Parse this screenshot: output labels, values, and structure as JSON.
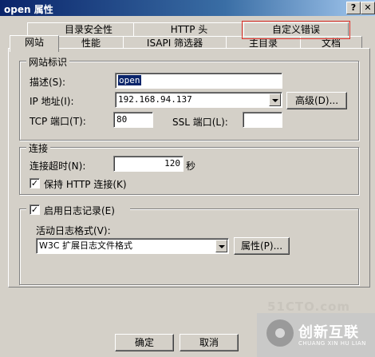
{
  "window": {
    "title": "open 属性",
    "help_label": "?",
    "close_label": "✕"
  },
  "tabs_row1": [
    "目录安全性",
    "HTTP 头",
    "自定义错误"
  ],
  "tabs_row2": [
    "网站",
    "性能",
    "ISAPI 筛选器",
    "主目录",
    "文档"
  ],
  "site_identity": {
    "group_title": "网站标识",
    "description_label": "描述(S):",
    "description_value": "open",
    "ip_label": "IP 地址(I):",
    "ip_value": "192.168.94.137",
    "advanced_button": "高级(D)...",
    "tcp_label": "TCP 端口(T):",
    "tcp_value": "80",
    "ssl_label": "SSL 端口(L):",
    "ssl_value": ""
  },
  "connections": {
    "group_title": "连接",
    "timeout_label": "连接超时(N):",
    "timeout_value": "120",
    "timeout_unit": "秒",
    "keepalive_label": "保持 HTTP 连接(K)",
    "keepalive_checked": true
  },
  "logging": {
    "enable_label": "启用日志记录(E)",
    "enable_checked": true,
    "format_label": "活动日志格式(V):",
    "format_value": "W3C 扩展日志文件格式",
    "properties_button": "属性(P)..."
  },
  "footer": {
    "ok_label": "确定",
    "cancel_label": "取消"
  },
  "watermark": {
    "site_text": "51CTO.com",
    "brand_cn": "创新互联",
    "brand_en": "CHUANG XIN HU LIAN"
  },
  "colors": {
    "highlight": "#e0302a",
    "titlebar": "#0a246a"
  }
}
